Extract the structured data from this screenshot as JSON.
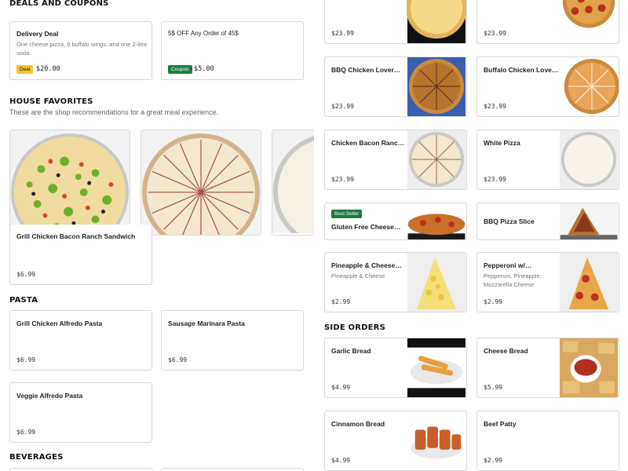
{
  "deals": {
    "title": "DEALS AND COUPONS",
    "items": [
      {
        "title": "Delivery Deal",
        "desc": "One cheese pizza, 6 buffalo wings, and one 2-litre soda.",
        "badge": "Deal",
        "price": "$20.00"
      },
      {
        "title": "5$ OFF Any Order of 45$",
        "badge": "Coupon",
        "price": "$5.00"
      }
    ]
  },
  "favorites": {
    "title": "HOUSE FAVORITES",
    "subtitle": "These are the shop recommendations for a great meal experience.",
    "item": {
      "title": "Grill Chicken Bacon Ranch Sandwich",
      "price": "$6.99"
    }
  },
  "pasta": {
    "title": "PASTA",
    "items": [
      {
        "title": "Grill Chicken Alfredo Pasta",
        "price": "$6.99"
      },
      {
        "title": "Sausage Marinara Pasta",
        "price": "$6.99"
      },
      {
        "title": "Veggie Alfredo Pasta",
        "price": "$6.99"
      }
    ]
  },
  "beverages": {
    "title": "BEVERAGES"
  },
  "pizzas": {
    "items": [
      {
        "title": "",
        "price": "$23.99"
      },
      {
        "title": "",
        "price": "$23.99"
      },
      {
        "title": "BBQ Chicken Lover…",
        "price": "$23.99"
      },
      {
        "title": "Buffalo Chicken Love…",
        "price": "$23.99"
      },
      {
        "title": "Chicken Bacon Ranc…",
        "price": "$23.99"
      },
      {
        "title": "White Pizza",
        "price": "$23.99"
      },
      {
        "title": "Gluten Free Cheese…",
        "badge": "Best Seller"
      },
      {
        "title": "BBQ Pizza Slice"
      },
      {
        "title": "Pineapple & Cheese…",
        "desc": "Pineapple & Cheese",
        "price": "$2.99"
      },
      {
        "title": "Pepperoni w/…",
        "desc": "Pepperoni, Pineapple, Mozzarella Cheese",
        "price": "$2.99"
      }
    ]
  },
  "sides": {
    "title": "SIDE ORDERS",
    "items": [
      {
        "title": "Garlic Bread",
        "price": "$4.99"
      },
      {
        "title": "Cheese Bread",
        "price": "$5.99"
      },
      {
        "title": "Cinnamon Bread",
        "price": "$4.99"
      },
      {
        "title": "Beef Patty",
        "price": "$2.99"
      }
    ]
  },
  "colors": {
    "accent_green": "#1f7a3f",
    "deal_yellow": "#f4c430",
    "border": "#d9d9d9"
  }
}
